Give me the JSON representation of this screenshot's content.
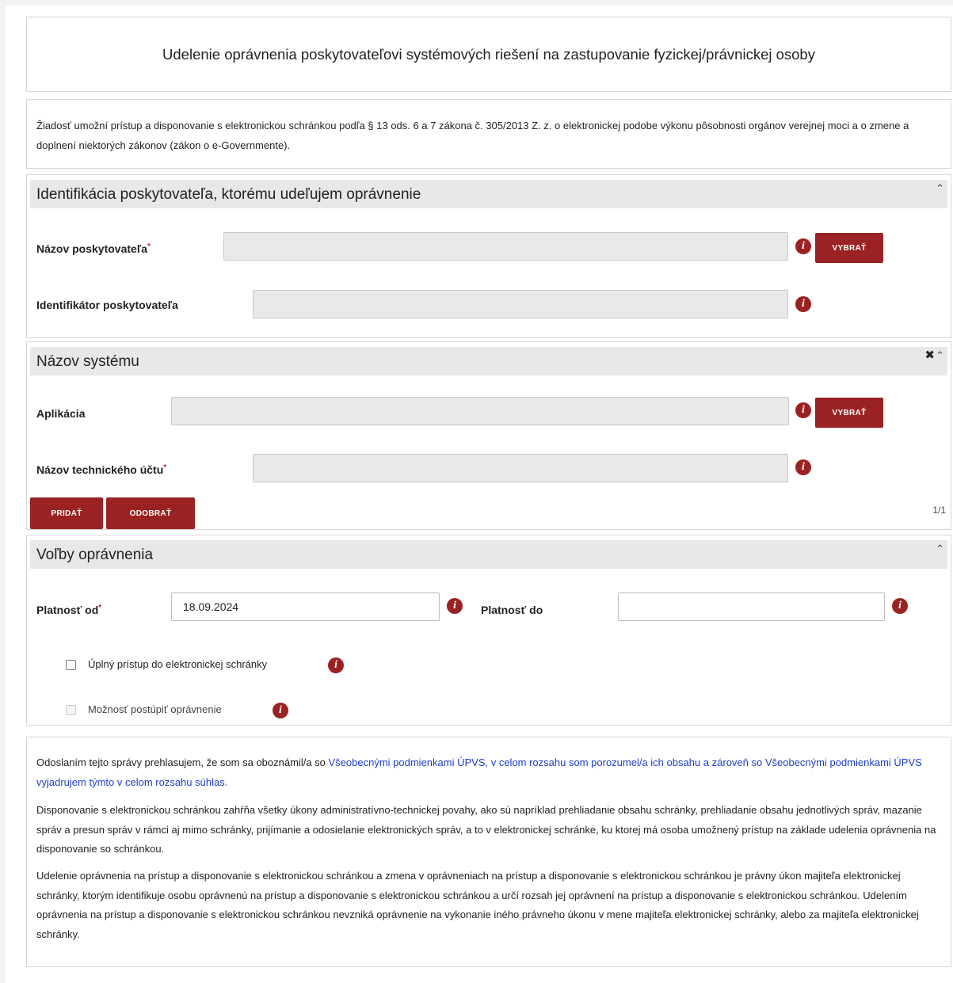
{
  "form": {
    "title": "Udelenie oprávnenia poskytovateľovi systémových riešení na zastupovanie fyzickej/právnickej osoby",
    "intro": "Žiadosť umožní prístup a disponovanie s elektronickou schránkou podľa § 13 ods. 6 a 7 zákona č. 305/2013 Z. z. o elektronickej podobe výkonu pôsobnosti orgánov verejnej moci a o zmene a doplnení niektorých zákonov (zákon o e-Governmente)."
  },
  "provider_section": {
    "title": "Identifikácia poskytovateľa, ktorému udeľujem oprávnenie",
    "collapse_icon": "caret-up-icon",
    "name_label": "Názov poskytovateľa",
    "name_value": "",
    "select_label": "VYBRAŤ",
    "id_label": "Identifikátor poskytovateľa",
    "id_value": ""
  },
  "system_section": {
    "title": "Názov systému",
    "remove_icon": "close-icon",
    "collapse_icon": "caret-up-icon",
    "app_label": "Aplikácia",
    "app_value": "",
    "select_label": "VYBRAŤ",
    "account_label": "Názov technického účtu",
    "account_value": "",
    "add_label": "PRIDAŤ",
    "remove_label": "ODOBRAŤ",
    "counter": "1/1"
  },
  "options_section": {
    "title": "Voľby oprávnenia",
    "collapse_icon": "caret-up-icon",
    "valid_from_label": "Platnosť od",
    "valid_from_value": "18.09.2024",
    "valid_to_label": "Platnosť do",
    "valid_to_value": "",
    "full_access_label": "Úplný prístup do elektronickej schránky",
    "full_access_checked": false,
    "delegate_label": "Možnosť postúpiť oprávnenie",
    "delegate_checked": false,
    "delegate_disabled": true
  },
  "required_marker": "*",
  "info_icon": "info-icon",
  "info_glyph": "i",
  "footer": {
    "consent_prefix": "Odoslaním tejto správy prehlasujem, že som sa oboznámil/a so ",
    "consent_link_1": "Všeobecnými podmienkami ÚPVS, v celom rozsahu som porozumel/a ich obsahu a zároveň so Všeobecnými podmienkami ÚPVS vyjadrujem týmto v celom rozsahu súhlas.",
    "paragraph_2": "Disponovanie s elektronickou schránkou zahŕňa všetky úkony administratívno-technickej povahy, ako sú napríklad prehliadanie obsahu schránky, prehliadanie obsahu jednotlivých správ, mazanie správ a presun správ v rámci aj mimo schránky, prijímanie a odosielanie elektronických správ, a to v elektronickej schránke, ku ktorej má osoba umožnený prístup na základe udelenia oprávnenia na disponovanie so schránkou.",
    "paragraph_3": "Udelenie oprávnenia na prístup a disponovanie s elektronickou schránkou a zmena v oprávneniach na prístup a disponovanie s elektronickou schránkou je právny úkon majiteľa elektronickej schránky, ktorým identifikuje osobu oprávnenú na prístup a disponovanie s elektronickou schránkou a určí rozsah jej oprávnení na prístup a disponovanie s elektronickou schránkou. Udelením oprávnenia na prístup a disponovanie s elektronickou schránkou nevzniká oprávnenie na vykonanie iného právneho úkonu v mene majiteľa elektronickej schránky, alebo za majiteľa elektronickej schránky."
  }
}
